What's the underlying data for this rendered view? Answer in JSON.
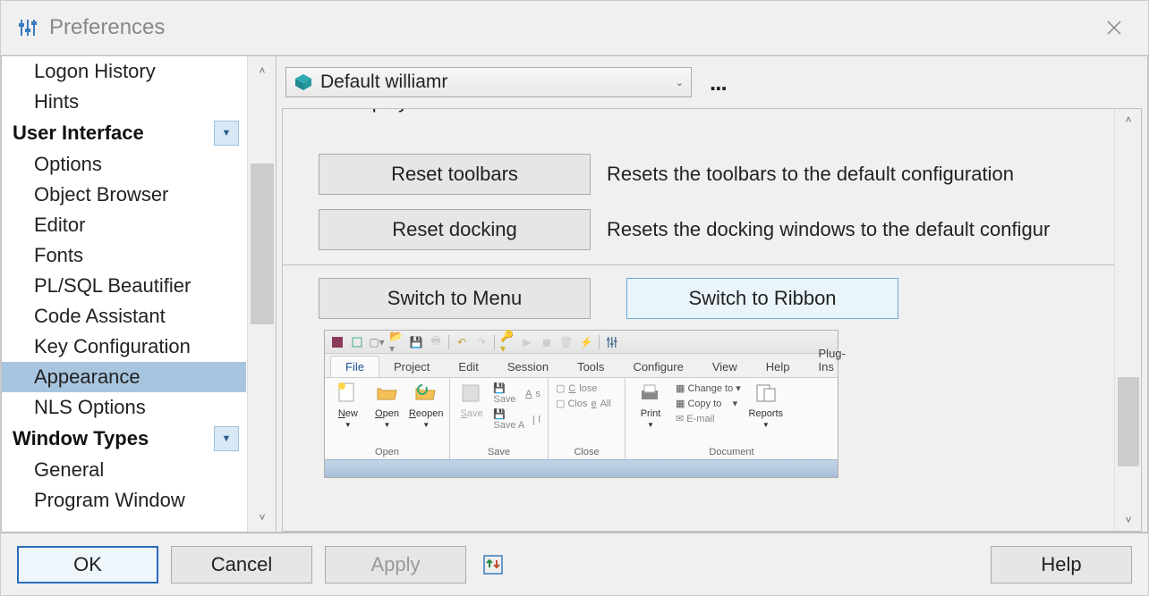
{
  "window": {
    "title": "Preferences"
  },
  "sidebar": {
    "items_above": [
      "Logon History",
      "Hints"
    ],
    "section_ui": "User Interface",
    "ui_items": [
      "Options",
      "Object Browser",
      "Editor",
      "Fonts",
      "PL/SQL Beautifier",
      "Code Assistant",
      "Key Configuration",
      "Appearance",
      "NLS Options"
    ],
    "selected": "Appearance",
    "section_wt": "Window Types",
    "wt_items": [
      "General",
      "Program Window"
    ]
  },
  "profile": {
    "label": "Default williamr",
    "ellipsis": "..."
  },
  "main": {
    "cut_header": "Display name",
    "reset_toolbars_btn": "Reset toolbars",
    "reset_toolbars_desc": "Resets the toolbars to the default configuration",
    "reset_docking_btn": "Reset docking",
    "reset_docking_desc": "Resets the docking windows to the default configur",
    "switch_menu_btn": "Switch to Menu",
    "switch_ribbon_btn": "Switch to Ribbon"
  },
  "ribbon_preview": {
    "tabs": [
      "File",
      "Project",
      "Edit",
      "Session",
      "Tools",
      "Configure",
      "View",
      "Help",
      "Plug-Ins"
    ],
    "active_tab": "File",
    "groups": {
      "open": {
        "label": "Open",
        "new": "New",
        "open_btn": "Open",
        "reopen": "Reopen"
      },
      "save": {
        "label": "Save",
        "save": "Save",
        "save_as": "Save As",
        "save_all": "Save All"
      },
      "close": {
        "label": "Close",
        "close": "Close",
        "close_all": "Close All"
      },
      "document": {
        "label": "Document",
        "print": "Print",
        "change_to": "Change to",
        "copy_to": "Copy to",
        "email": "E-mail",
        "reports": "Reports"
      }
    }
  },
  "buttons": {
    "ok": "OK",
    "cancel": "Cancel",
    "apply": "Apply",
    "help": "Help"
  }
}
